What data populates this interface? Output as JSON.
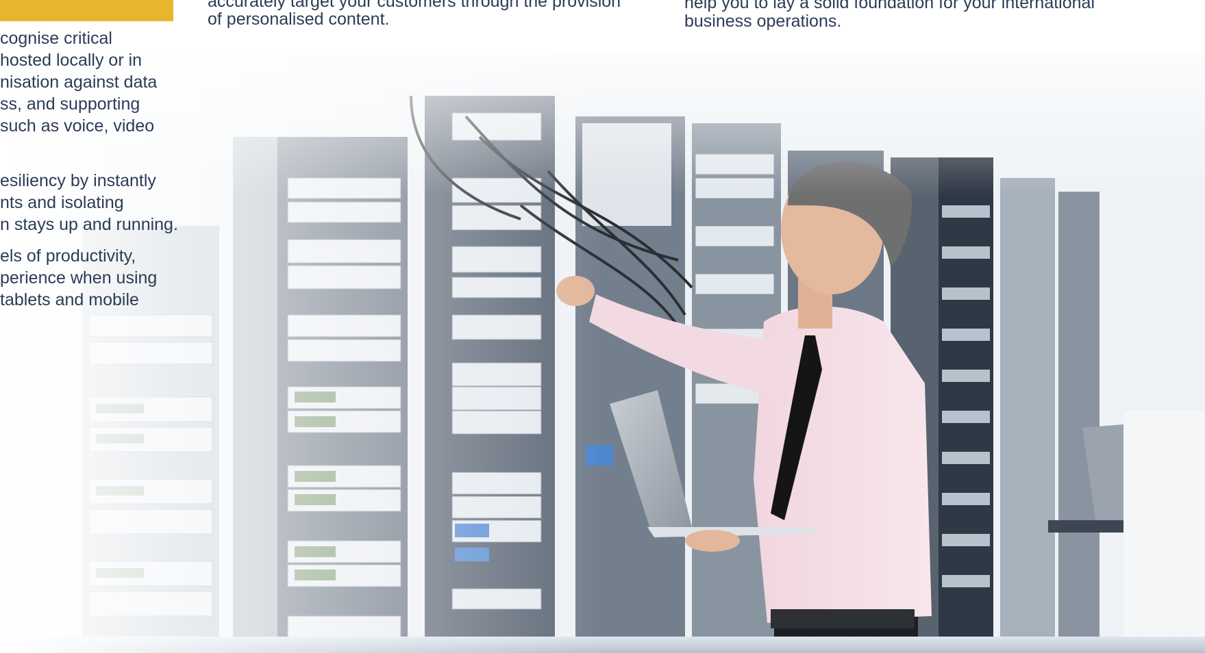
{
  "colors": {
    "accent": "#E8B52C",
    "text": "#2B3C55",
    "rack": "#B9C1CB",
    "shirt": "#F4DCE4"
  },
  "left_column": {
    "para1_lines": [
      "cognise critical",
      "hosted locally or in",
      "nisation against data",
      "ss, and supporting",
      "such as voice, video"
    ],
    "para2_lines": [
      "esiliency by instantly",
      "nts and isolating",
      "n stays up and running."
    ],
    "para3_lines": [
      "els of productivity,",
      "perience when using",
      "tablets and mobile"
    ]
  },
  "middle_column": {
    "lines": [
      "accurately target your customers through the provision",
      "of personalised content."
    ]
  },
  "right_column": {
    "lines": [
      "help you to lay a solid foundation for your international",
      "business operations."
    ]
  },
  "photo": {
    "subject": "technician-with-laptop-in-server-room"
  }
}
